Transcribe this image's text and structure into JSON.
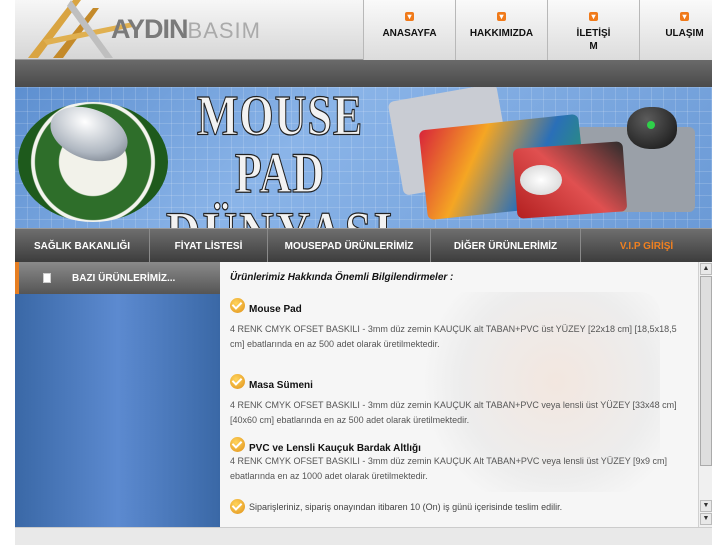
{
  "logo": {
    "part1": "AYDIN",
    "part2": "BASIM"
  },
  "topnav": [
    {
      "label": "ANASAYFA"
    },
    {
      "label": "HAKKIMIZDA"
    },
    {
      "label": "İLETİŞİM"
    },
    {
      "label": "ULAŞIM"
    }
  ],
  "banner": {
    "line1": "MOUSE PAD",
    "line2": "DÜNYASI"
  },
  "menubar": [
    {
      "label": "SAĞLIK BAKANLIĞI"
    },
    {
      "label": "FİYAT LİSTESİ"
    },
    {
      "label": "MOUSEPAD ÜRÜNLERİMİZ"
    },
    {
      "label": "DİĞER ÜRÜNLERİMİZ"
    },
    {
      "label": "V.I.P GİRİŞİ"
    }
  ],
  "sidebar": {
    "heading": "BAZI ÜRÜNLERİMİZ..."
  },
  "content": {
    "intro": "Ürünlerimiz Hakkında Önemli Bilgilendirmeler :",
    "products": [
      {
        "title": "Mouse Pad",
        "desc": "4 RENK CMYK OFSET BASKILI - 3mm düz zemin KAUÇUK alt TABAN+PVC üst YÜZEY [22x18 cm] [18,5x18,5 cm] ebatlarında en az 500 adet olarak üretilmektedir."
      },
      {
        "title": "Masa Sümeni",
        "desc": "4 RENK CMYK OFSET BASKILI - 3mm düz zemin KAUÇUK alt TABAN+PVC veya lensli üst YÜZEY [33x48 cm] [40x60 cm] ebatlarında en az 500 adet olarak üretilmektedir."
      },
      {
        "title": "PVC ve Lensli Kauçuk Bardak Altlığı",
        "desc": "4 RENK CMYK OFSET BASKILI - 3mm düz zemin KAUÇUK  Alt TABAN+PVC veya lensli üst YÜZEY [9x9 cm] ebatlarında en az 1000 adet olarak üretilmektedir."
      }
    ],
    "note": "Siparişleriniz, sipariş onayından itibaren 10 (On) iş günü içerisinde teslim edilir."
  },
  "icons": {
    "nav_dot": "arrow-down-icon",
    "sidebar": "document-icon",
    "check": "checkmark-icon"
  },
  "colors": {
    "accent": "#f07a1a",
    "sidebar_blue": "#4a78b8",
    "vip": "#f08020"
  }
}
